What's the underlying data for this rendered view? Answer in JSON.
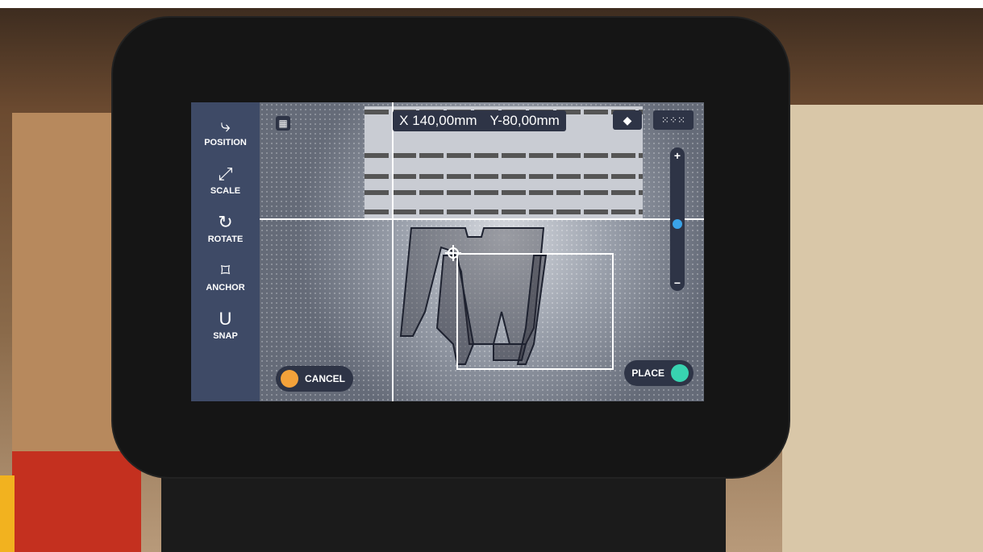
{
  "toolbar": {
    "items": [
      {
        "label": "POSITION",
        "icon": "position-icon"
      },
      {
        "label": "SCALE",
        "icon": "scale-icon"
      },
      {
        "label": "ROTATE",
        "icon": "rotate-icon"
      },
      {
        "label": "ANCHOR",
        "icon": "anchor-icon"
      },
      {
        "label": "SNAP",
        "icon": "snap-icon"
      }
    ]
  },
  "coordinates": {
    "x": "X 140,00mm",
    "y": "Y-80,00mm"
  },
  "zoom": {
    "plus": "+",
    "minus": "−",
    "level": 0.45
  },
  "actions": {
    "cancel_label": "CANCEL",
    "place_label": "PLACE"
  },
  "colors": {
    "cancel_accent": "#f4a23a",
    "place_accent": "#38d3b0",
    "zoom_knob": "#3aa3e8",
    "panel": "#3e4a66"
  }
}
